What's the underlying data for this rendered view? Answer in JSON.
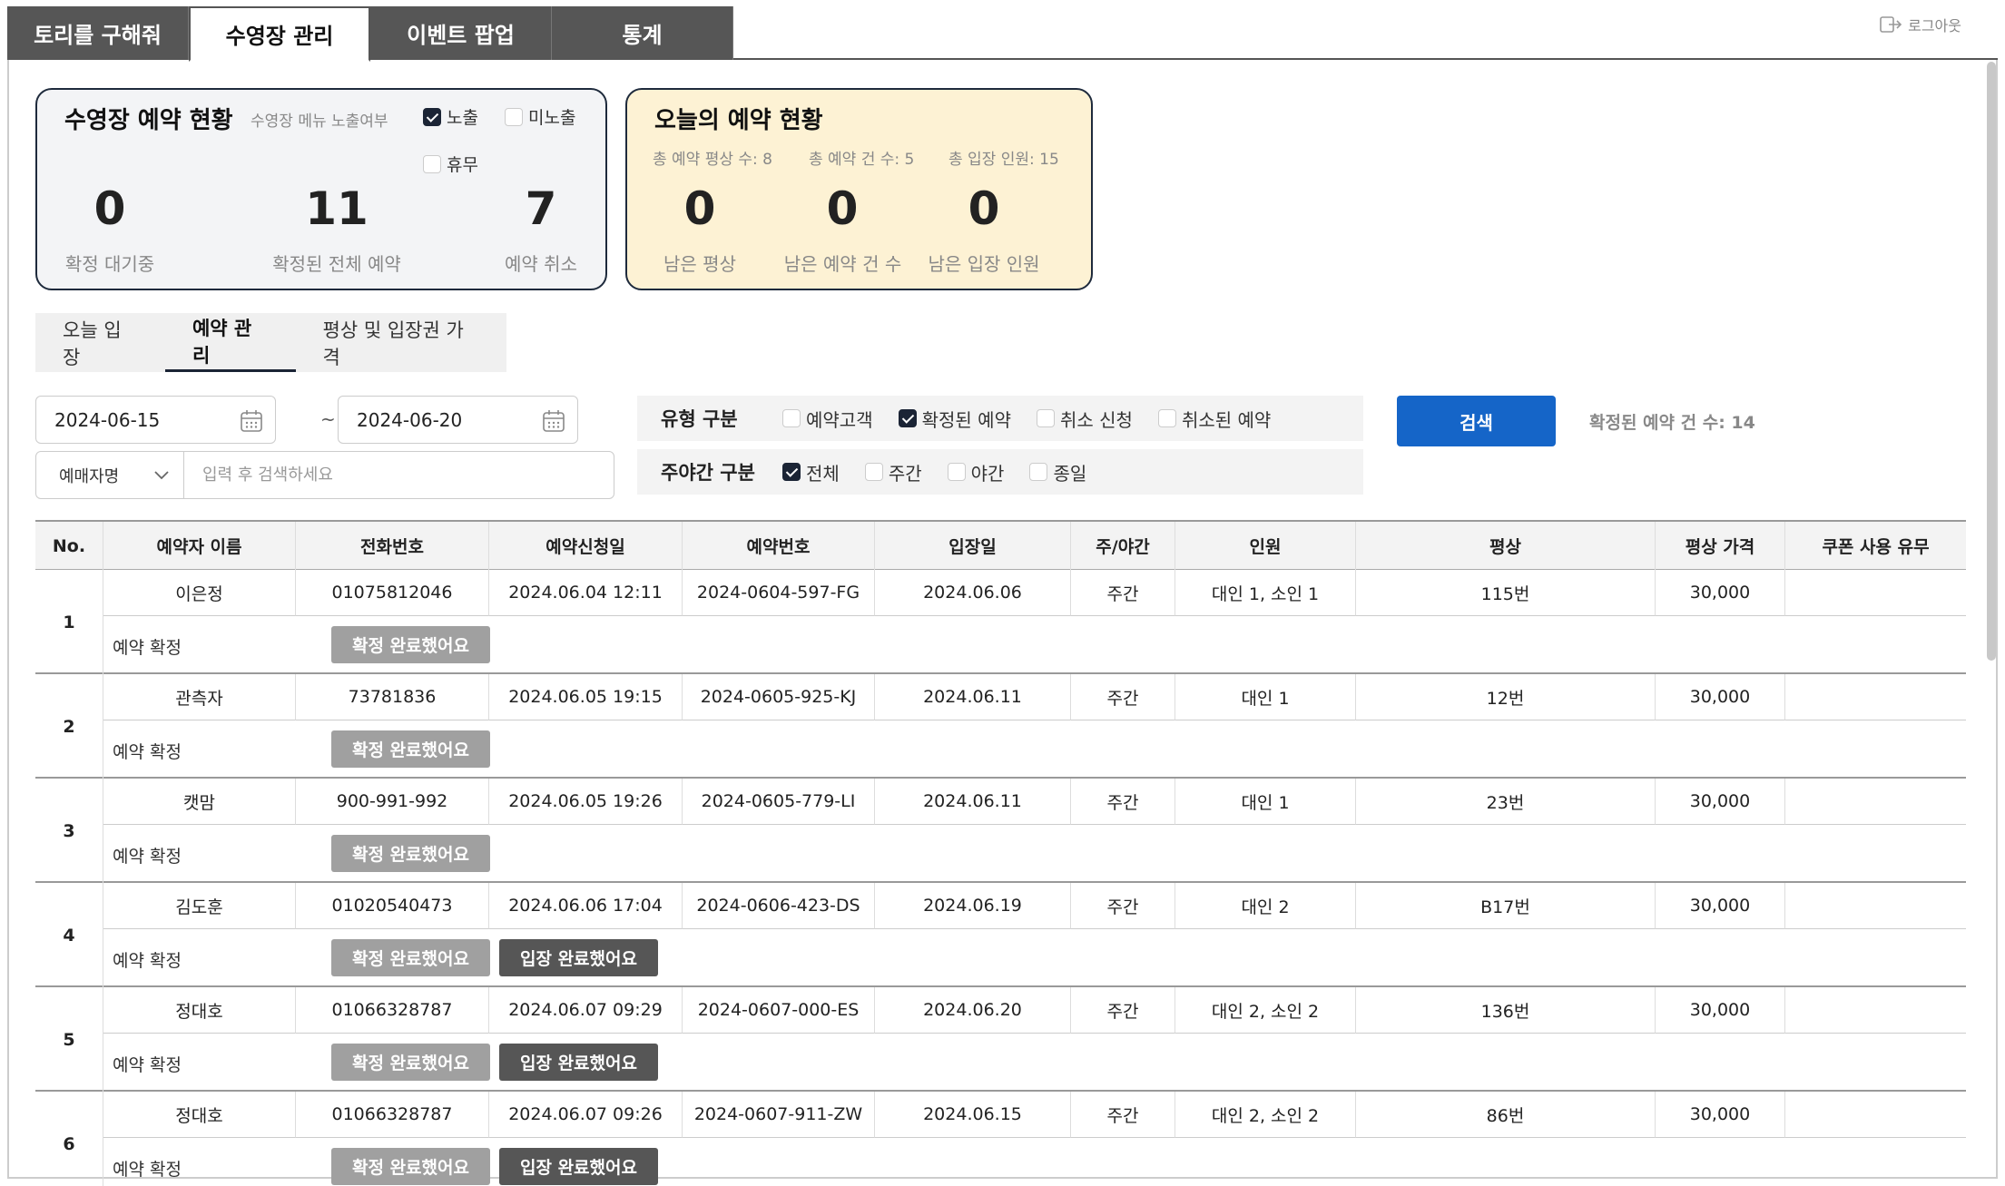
{
  "top_tabs": [
    "토리를 구해줘",
    "수영장 관리",
    "이벤트 팝업",
    "통계"
  ],
  "logout_label": "로그아웃",
  "pool_card": {
    "title": "수영장 예약 현황",
    "menu_label": "수영장 메뉴 노출여부",
    "opt_show": "노출",
    "opt_hide": "미노출",
    "opt_closed": "휴무",
    "stats": [
      {
        "value": "0",
        "label": "확정 대기중"
      },
      {
        "value": "11",
        "label": "확정된 전체 예약"
      },
      {
        "value": "7",
        "label": "예약 취소"
      }
    ]
  },
  "today_card": {
    "title": "오늘의 예약 현황",
    "sub1": "총 예약 평상 수: 8",
    "sub2": "총 예약 건 수: 5",
    "sub3": "총 입장 인원: 15",
    "stats": [
      {
        "value": "0",
        "label": "남은 평상"
      },
      {
        "value": "0",
        "label": "남은 예약 건 수"
      },
      {
        "value": "0",
        "label": "남은 입장 인원"
      }
    ]
  },
  "sub_tabs": [
    "오늘 입장",
    "예약 관리",
    "평상 및 입장권 가격"
  ],
  "filters": {
    "date_from": "2024-06-15",
    "date_to": "2024-06-20",
    "tilde": "~",
    "select_value": "예매자명",
    "search_placeholder": "입력 후 검색하세요",
    "type_label": "유형 구분",
    "type_opts": [
      "예약고객",
      "확정된 예약",
      "취소 신청",
      "취소된 예약"
    ],
    "time_label": "주야간 구분",
    "time_opts": [
      "전체",
      "주간",
      "야간",
      "종일"
    ],
    "search_button": "검색",
    "count_text": "확정된 예약 건 수: 14"
  },
  "table": {
    "headers": [
      "No.",
      "예약자 이름",
      "전화번호",
      "예약신청일",
      "예약번호",
      "입장일",
      "주/야간",
      "인원",
      "평상",
      "평상 가격",
      "쿠폰 사용 유무"
    ],
    "action_label": "예약 확정",
    "confirm_label": "확정 완료했어요",
    "entry_label": "입장 완료했어요",
    "rows": [
      {
        "no": "1",
        "name": "이은정",
        "phone": "01075812046",
        "applied": "2024.06.04  12:11",
        "resno": "2024-0604-597-FG",
        "date": "2024.06.06",
        "time": "주간",
        "people": "대인 1, 소인 1",
        "seat": "115번",
        "price": "30,000",
        "coupon": ""
      },
      {
        "no": "2",
        "name": "관측자",
        "phone": "73781836",
        "applied": "2024.06.05  19:15",
        "resno": "2024-0605-925-KJ",
        "date": "2024.06.11",
        "time": "주간",
        "people": "대인 1",
        "seat": "12번",
        "price": "30,000",
        "coupon": ""
      },
      {
        "no": "3",
        "name": "캣맘",
        "phone": "900-991-992",
        "applied": "2024.06.05  19:26",
        "resno": "2024-0605-779-LI",
        "date": "2024.06.11",
        "time": "주간",
        "people": "대인 1",
        "seat": "23번",
        "price": "30,000",
        "coupon": ""
      },
      {
        "no": "4",
        "name": "김도훈",
        "phone": "01020540473",
        "applied": "2024.06.06  17:04",
        "resno": "2024-0606-423-DS",
        "date": "2024.06.19",
        "time": "주간",
        "people": "대인 2",
        "seat": "B17번",
        "price": "30,000",
        "coupon": ""
      },
      {
        "no": "5",
        "name": "정대호",
        "phone": "01066328787",
        "applied": "2024.06.07  09:29",
        "resno": "2024-0607-000-ES",
        "date": "2024.06.20",
        "time": "주간",
        "people": "대인 2, 소인 2",
        "seat": "136번",
        "price": "30,000",
        "coupon": ""
      },
      {
        "no": "6",
        "name": "정대호",
        "phone": "01066328787",
        "applied": "2024.06.07  09:26",
        "resno": "2024-0607-911-ZW",
        "date": "2024.06.15",
        "time": "주간",
        "people": "대인 2, 소인 2",
        "seat": "86번",
        "price": "30,000",
        "coupon": ""
      }
    ]
  }
}
